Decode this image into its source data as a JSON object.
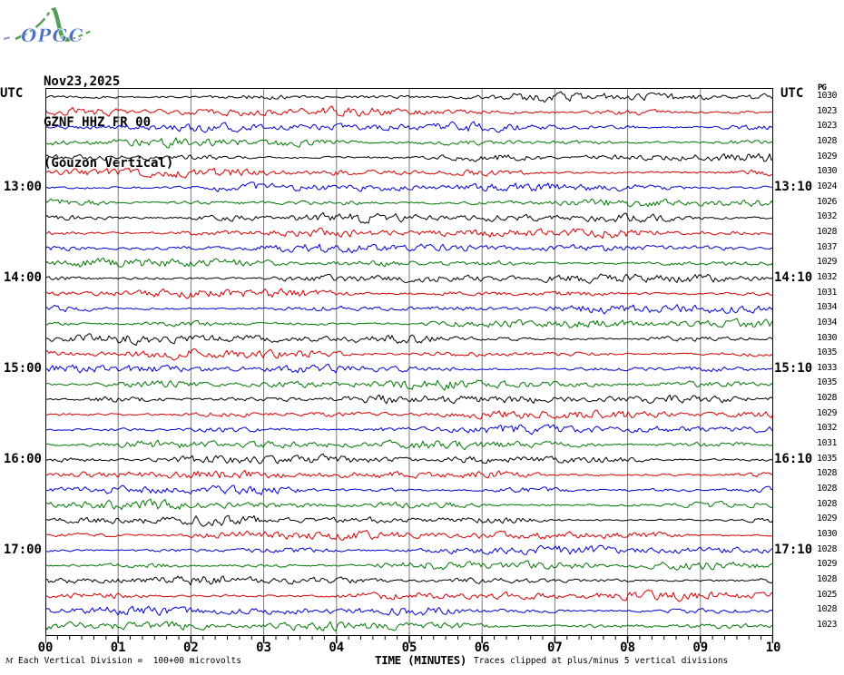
{
  "logo": {
    "text": "OPGC"
  },
  "header": {
    "date": "Nov23,2025",
    "channel": "GZNF HHZ FR 00",
    "station": "(Gouzon Vertical)"
  },
  "axes": {
    "left_title": "UTC",
    "right_title": "UTC",
    "right_col_header": "PG",
    "x_label": "TIME (MINUTES)",
    "x_ticks": [
      "00",
      "01",
      "02",
      "03",
      "04",
      "05",
      "06",
      "07",
      "08",
      "09",
      "10"
    ]
  },
  "footer": {
    "corner_mark": "M",
    "scale_note": "Each Vertical Division =  100+00 microvolts",
    "clip_note": "Traces clipped at plus/minus 5 vertical divisions"
  },
  "colors": {
    "black": "#000000",
    "red": "#d40000",
    "blue": "#0000cc",
    "green": "#007700",
    "grid": "#7a7a7a",
    "border": "#000000",
    "logo_green": "#55a055",
    "logo_blue": "#4a6fc4",
    "logo_dash": "#8899bb"
  },
  "chart_data": {
    "type": "line",
    "subtype": "helicorder-seismogram",
    "title": "GZNF HHZ FR 00 (Gouzon Vertical) Nov23,2025",
    "xlabel": "TIME (MINUTES)",
    "x_range_minutes": [
      0,
      10
    ],
    "x_major_tick_every_minutes": 1,
    "x_minor_ticks_per_minute": 5,
    "minutes_per_row": 10,
    "grid": true,
    "clip_divisions": 5,
    "microvolts_per_division": "100+00",
    "trace_color_cycle": [
      "black",
      "red",
      "blue",
      "green"
    ],
    "rows": [
      {
        "color": "black",
        "left": "",
        "right": "",
        "pg": "1030"
      },
      {
        "color": "red",
        "left": "",
        "right": "",
        "pg": "1023"
      },
      {
        "color": "blue",
        "left": "",
        "right": "",
        "pg": "1023"
      },
      {
        "color": "green",
        "left": "",
        "right": "",
        "pg": "1028"
      },
      {
        "color": "black",
        "left": "",
        "right": "",
        "pg": "1029"
      },
      {
        "color": "red",
        "left": "",
        "right": "",
        "pg": "1030"
      },
      {
        "color": "blue",
        "left": "13:00",
        "right": "13:10",
        "pg": "1024"
      },
      {
        "color": "green",
        "left": "",
        "right": "",
        "pg": "1026"
      },
      {
        "color": "black",
        "left": "",
        "right": "",
        "pg": "1032"
      },
      {
        "color": "red",
        "left": "",
        "right": "",
        "pg": "1028"
      },
      {
        "color": "blue",
        "left": "",
        "right": "",
        "pg": "1037"
      },
      {
        "color": "green",
        "left": "",
        "right": "",
        "pg": "1029"
      },
      {
        "color": "black",
        "left": "14:00",
        "right": "14:10",
        "pg": "1032"
      },
      {
        "color": "red",
        "left": "",
        "right": "",
        "pg": "1031"
      },
      {
        "color": "blue",
        "left": "",
        "right": "",
        "pg": "1034"
      },
      {
        "color": "green",
        "left": "",
        "right": "",
        "pg": "1034"
      },
      {
        "color": "black",
        "left": "",
        "right": "",
        "pg": "1030"
      },
      {
        "color": "red",
        "left": "",
        "right": "",
        "pg": "1035"
      },
      {
        "color": "blue",
        "left": "15:00",
        "right": "15:10",
        "pg": "1033"
      },
      {
        "color": "green",
        "left": "",
        "right": "",
        "pg": "1035"
      },
      {
        "color": "black",
        "left": "",
        "right": "",
        "pg": "1028"
      },
      {
        "color": "red",
        "left": "",
        "right": "",
        "pg": "1029"
      },
      {
        "color": "blue",
        "left": "",
        "right": "",
        "pg": "1032"
      },
      {
        "color": "green",
        "left": "",
        "right": "",
        "pg": "1031"
      },
      {
        "color": "black",
        "left": "16:00",
        "right": "16:10",
        "pg": "1035"
      },
      {
        "color": "red",
        "left": "",
        "right": "",
        "pg": "1028"
      },
      {
        "color": "blue",
        "left": "",
        "right": "",
        "pg": "1028"
      },
      {
        "color": "green",
        "left": "",
        "right": "",
        "pg": "1028"
      },
      {
        "color": "black",
        "left": "",
        "right": "",
        "pg": "1029"
      },
      {
        "color": "red",
        "left": "",
        "right": "",
        "pg": "1030"
      },
      {
        "color": "blue",
        "left": "17:00",
        "right": "17:10",
        "pg": "1028"
      },
      {
        "color": "green",
        "left": "",
        "right": "",
        "pg": "1029"
      },
      {
        "color": "black",
        "left": "",
        "right": "",
        "pg": "1028"
      },
      {
        "color": "red",
        "left": "",
        "right": "",
        "pg": "1025"
      },
      {
        "color": "blue",
        "left": "",
        "right": "",
        "pg": "1028"
      },
      {
        "color": "green",
        "left": "",
        "right": "",
        "pg": "1023"
      }
    ],
    "render": {
      "seed": 20251123,
      "seed_step": 101
    }
  }
}
